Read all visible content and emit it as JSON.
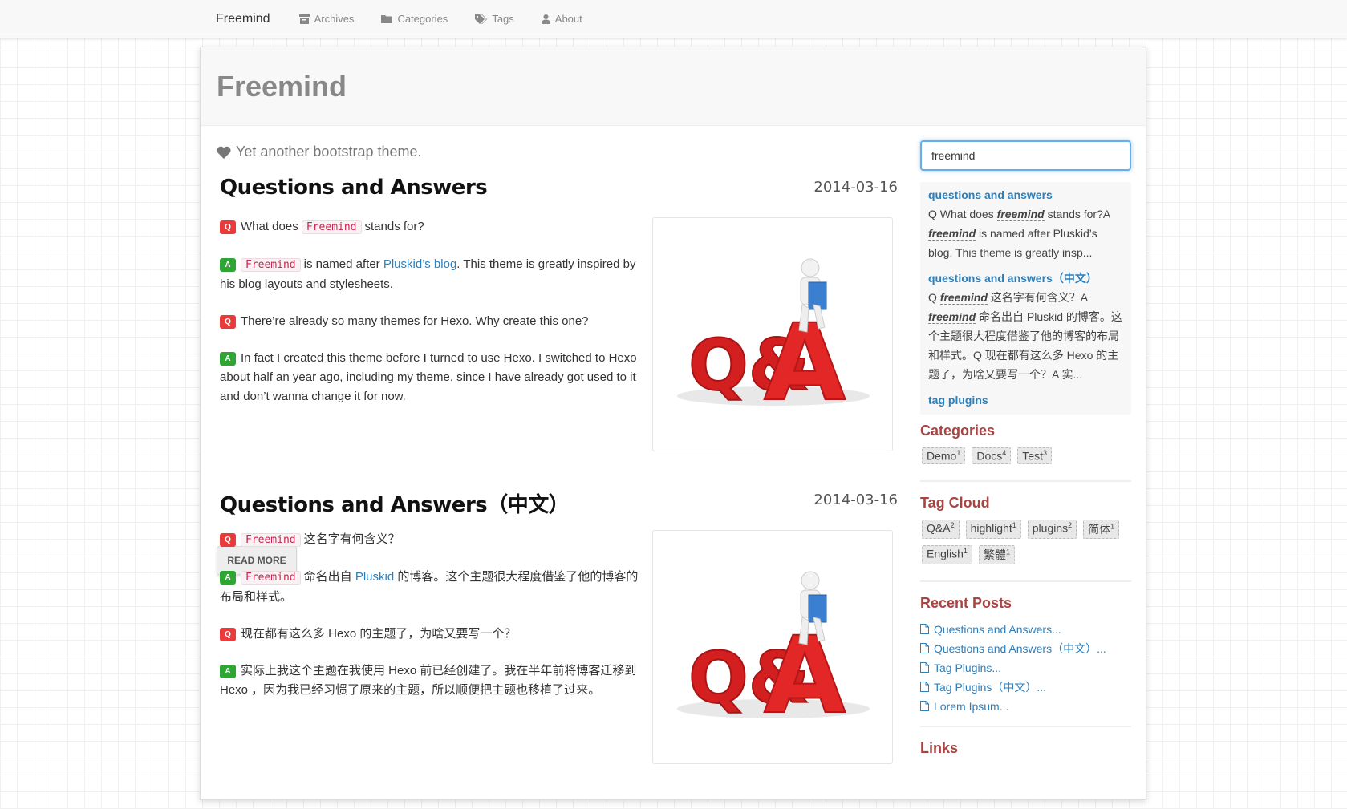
{
  "nav": {
    "brand": "Freemind",
    "items": [
      {
        "label": "Archives",
        "icon": "archive-icon"
      },
      {
        "label": "Categories",
        "icon": "folder-icon"
      },
      {
        "label": "Tags",
        "icon": "tags-icon"
      },
      {
        "label": "About",
        "icon": "user-icon"
      }
    ]
  },
  "header": {
    "title": "Freemind"
  },
  "tagline": "Yet another bootstrap theme.",
  "posts": [
    {
      "title": "Questions and Answers",
      "date": "2014-03-16",
      "q1_pre": "What does",
      "code": "Freemind",
      "q1_post": "stands for?",
      "a1_pre": "is named after",
      "a1_link": "Pluskid’s blog",
      "a1_post": ". This theme is greatly inspired by his blog layouts and stylesheets.",
      "q2": "There’re already so many themes for Hexo. Why create this one?",
      "a2": "In fact I created this theme before I turned to use Hexo. I switched to Hexo about half an year ago, including my theme, since I have already got used to it and don’t wanna change it for now.",
      "read_more": "READ MORE"
    },
    {
      "title": "Questions and Answers（中文）",
      "date": "2014-03-16",
      "code": "Freemind",
      "q1_post": "这名字有何含义？",
      "a1_pre": "命名出自",
      "a1_link": "Pluskid",
      "a1_post": "的博客。这个主题很大程度借鉴了他的博客的布局和样式。",
      "q2": "现在都有这么多 Hexo 的主题了，为啥又要写一个？",
      "a2": "实际上我这个主题在我使用 Hexo 前已经创建了。我在半年前将博客迁移到 Hexo ，因为我已经习惯了原来的主题，所以顺便把主题也移植了过来。"
    }
  ],
  "badges": {
    "q": "Q",
    "a": "A"
  },
  "search": {
    "value": "freemind",
    "results": [
      {
        "title": "questions and answers",
        "t1": "Q What does",
        "em1": "freemind",
        "t2": "stands for?A",
        "em2": "freemind",
        "t3": "is named after Pluskid’s blog. This theme is greatly insp..."
      },
      {
        "title": "questions and answers（中文）",
        "t1": "Q",
        "em1": "freemind",
        "t2": "这名字有何含义？A",
        "em2": "freemind",
        "t3": "命名出自 Pluskid 的博客。这个主题很大程度借鉴了他的博客的布局和样式。Q 现在都有这么多 Hexo 的主题了，为啥又要写一个？A 实..."
      },
      {
        "title": "tag plugins"
      }
    ]
  },
  "categories": {
    "heading": "Categories",
    "items": [
      {
        "name": "Demo",
        "count": "1"
      },
      {
        "name": "Docs",
        "count": "4"
      },
      {
        "name": "Test",
        "count": "3"
      }
    ]
  },
  "tag_cloud": {
    "heading": "Tag Cloud",
    "items": [
      {
        "name": "Q&A",
        "count": "2"
      },
      {
        "name": "highlight",
        "count": "1"
      },
      {
        "name": "plugins",
        "count": "2"
      },
      {
        "name": "简体",
        "count": "1"
      },
      {
        "name": "English",
        "count": "1"
      },
      {
        "name": "繁體",
        "count": "1"
      }
    ]
  },
  "recent_posts": {
    "heading": "Recent Posts",
    "items": [
      "Questions and Answers...",
      "Questions and Answers（中文）...",
      "Tag Plugins...",
      "Tag Plugins（中文）...",
      "Lorem Ipsum..."
    ]
  },
  "links": {
    "heading": "Links"
  },
  "colors": {
    "accent": "#2a7fbd",
    "heading": "#a94442",
    "q": "#e93b3b",
    "a": "#2fa533"
  }
}
